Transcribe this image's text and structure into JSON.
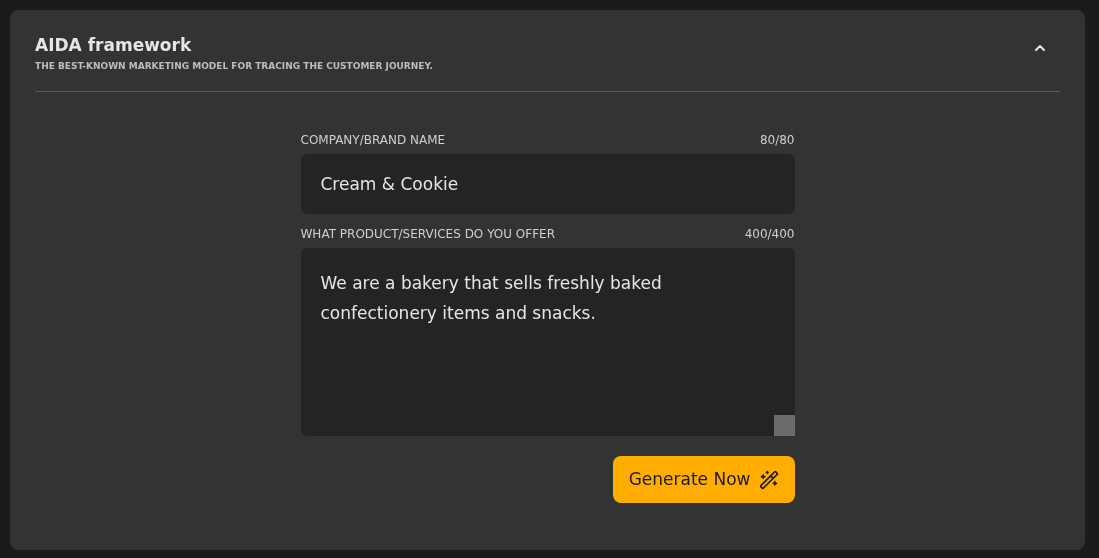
{
  "panel": {
    "title": "AIDA framework",
    "subtitle": "THE BEST-KNOWN MARKETING MODEL FOR TRACING THE CUSTOMER JOURNEY.",
    "expanded": true
  },
  "fields": [
    {
      "kind": "input",
      "label": "COMPANY/BRAND NAME",
      "count": "80/80",
      "value": "Cream & Cookie"
    },
    {
      "kind": "textarea",
      "label": "WHAT PRODUCT/SERVICES DO YOU OFFER",
      "count": "400/400",
      "value": "We are a bakery that sells freshly baked confectionery items and snacks."
    }
  ],
  "button": {
    "label": "Generate Now"
  }
}
